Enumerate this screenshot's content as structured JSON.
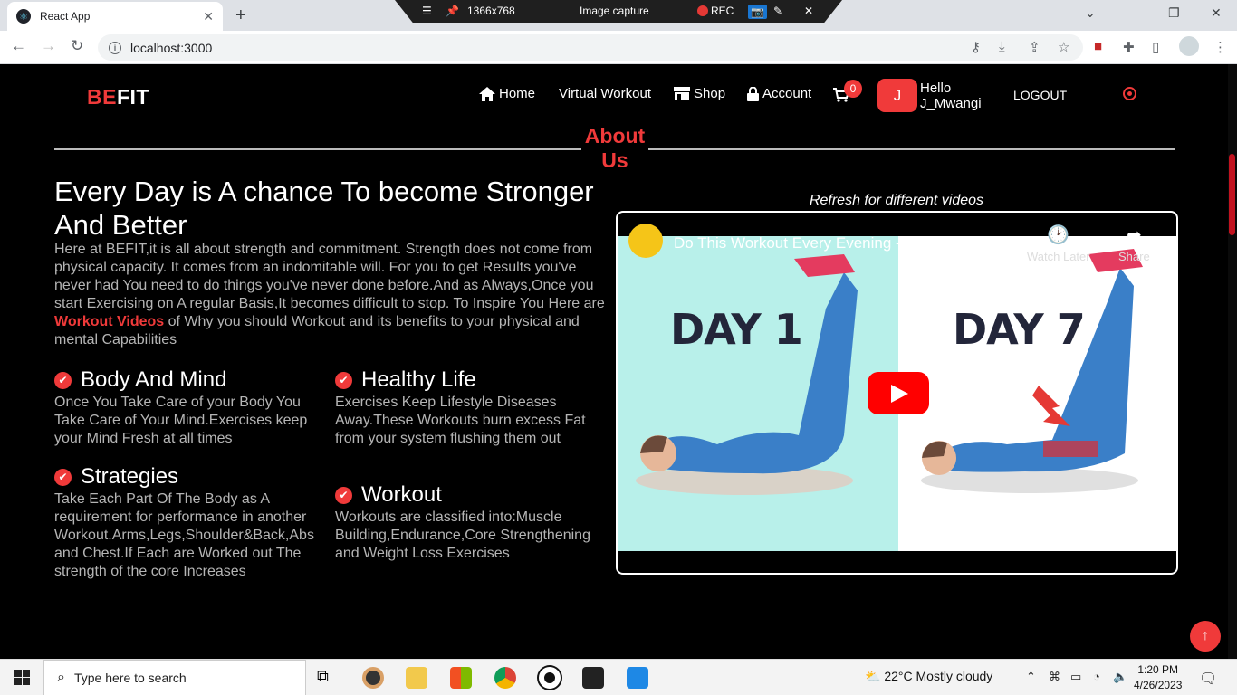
{
  "browser": {
    "tab_title": "React App",
    "tab_close": "✕",
    "new_tab": "+",
    "url": "localhost:3000",
    "capture": {
      "size": "1366x768",
      "label": "Image capture",
      "rec": "REC"
    }
  },
  "navbar": {
    "logo_be": "BE",
    "logo_fit": "FIT",
    "items": [
      {
        "label": "Home",
        "icon": "home-icon"
      },
      {
        "label": "Virtual Workout"
      },
      {
        "label": "Shop",
        "icon": "store-icon"
      },
      {
        "label": "Account",
        "icon": "lock-icon"
      }
    ],
    "cart_count": "0",
    "avatar_initial": "J",
    "hello": "Hello",
    "username": "J_Mwangi",
    "logout": "LOGOUT"
  },
  "section": {
    "title_line1": "About",
    "title_line2": "Us",
    "headline": "Every Day is A chance To become Stronger And Better",
    "intro_before": "Here at BEFIT,it is all about strength and commitment. Strength does not come from physical capacity. It comes from an indomitable will. For you to get Results you've never had You need to do things you've never done before.And as Always,Once you start Exercising on A regular Basis,It becomes difficult to stop. To Inspire You Here are ",
    "intro_highlight": "Workout Videos",
    "intro_after": " of Why you should Workout and its benefits to your physical and mental Capabilities",
    "features": [
      {
        "title": "Body And Mind",
        "body": "Once You Take Care of your Body You Take Care of Your Mind.Exercises keep your Mind Fresh at all times"
      },
      {
        "title": "Healthy Life",
        "body": "Exercises Keep Lifestyle Diseases Away.These Workouts burn excess Fat from your system flushing them out"
      },
      {
        "title": "Strategies",
        "body": "Take Each Part Of The Body as A requirement for performance in another Workout.Arms,Legs,Shoulder&Back,Abs and Chest.If Each are Worked out The strength of the core Increases"
      },
      {
        "title": "Workout",
        "body": "Workouts are classified into:Muscle Building,Endurance,Core Strengthening and Weight Loss Exercises"
      }
    ]
  },
  "video": {
    "refresh_note": "Refresh for different videos",
    "title": "Do This Workout Every Evening - Best Evening ...",
    "watch_later": "Watch Later",
    "share": "Share",
    "day_left": "DAY 1",
    "day_right": "DAY 7"
  },
  "taskbar": {
    "search_placeholder": "Type here to search",
    "weather": "22°C  Mostly cloudy",
    "time": "1:20 PM",
    "date": "4/26/2023"
  },
  "colors": {
    "accent": "#f03a3a",
    "background": "#000000",
    "muted_text": "#b5b5b5"
  }
}
